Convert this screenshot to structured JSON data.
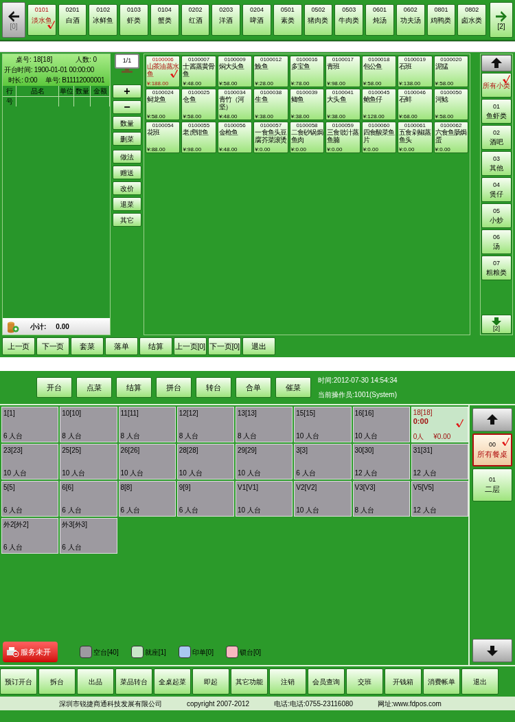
{
  "order_screen": {
    "category_bar": {
      "prev_page": "[0]",
      "next_page": "[2]",
      "categories": [
        {
          "code": "0101",
          "name": "淡水鱼",
          "selected": true
        },
        {
          "code": "0201",
          "name": "白酒",
          "selected": false
        },
        {
          "code": "0102",
          "name": "冰鲜鱼",
          "selected": false
        },
        {
          "code": "0103",
          "name": "虾类",
          "selected": false
        },
        {
          "code": "0104",
          "name": "蟹类",
          "selected": false
        },
        {
          "code": "0202",
          "name": "红酒",
          "selected": false
        },
        {
          "code": "0203",
          "name": "洋酒",
          "selected": false
        },
        {
          "code": "0204",
          "name": "啤酒",
          "selected": false
        },
        {
          "code": "0501",
          "name": "素类",
          "selected": false
        },
        {
          "code": "0502",
          "name": "猪肉类",
          "selected": false
        },
        {
          "code": "0503",
          "name": "牛肉类",
          "selected": false
        },
        {
          "code": "0601",
          "name": "炖汤",
          "selected": false
        },
        {
          "code": "0602",
          "name": "功夫汤",
          "selected": false
        },
        {
          "code": "0801",
          "name": "鸡鸭类",
          "selected": false
        },
        {
          "code": "0802",
          "name": "卤水类",
          "selected": false
        }
      ]
    },
    "order_info": {
      "table_no": "桌号: 18[18]",
      "guests": "人数: 0",
      "open_time": "开台时间: 1900-01-01 00:00:00",
      "duration": "时长: 0:00",
      "bill_no": "单号: B11112000001"
    },
    "order_table": {
      "columns": [
        "行号",
        "品名",
        "单位",
        "数量",
        "金额"
      ],
      "subtotal_label": "小计:",
      "subtotal": "0.00"
    },
    "page_indicator": "1/1",
    "edit_buttons": [
      "+",
      "−",
      "数量",
      "删菜",
      "做法",
      "赠送",
      "改价",
      "退菜",
      "其它"
    ],
    "dishes": [
      {
        "code": "0100006",
        "name": "山茶油蒸水鱼",
        "price": "¥:188.00",
        "selected": true
      },
      {
        "code": "0100007",
        "name": "士酱蒸黄骨鱼",
        "price": "¥:48.00",
        "selected": false
      },
      {
        "code": "0100009",
        "name": "焖大头鱼",
        "price": "¥:58.00",
        "selected": false
      },
      {
        "code": "0100012",
        "name": "鮸鱼",
        "price": "¥:28.00",
        "selected": false
      },
      {
        "code": "0100016",
        "name": "多宝鱼",
        "price": "¥:78.00",
        "selected": false
      },
      {
        "code": "0100017",
        "name": "青班",
        "price": "¥:98.00",
        "selected": false
      },
      {
        "code": "0100018",
        "name": "包公鱼",
        "price": "¥:58.00",
        "selected": false
      },
      {
        "code": "0100019",
        "name": "石班",
        "price": "¥:138.00",
        "selected": false
      },
      {
        "code": "0100020",
        "name": "泥猛",
        "price": "¥:58.00",
        "selected": false
      },
      {
        "code": "0100024",
        "name": "鲟龙鱼",
        "price": "¥:58.00",
        "selected": false
      },
      {
        "code": "0100025",
        "name": "仓鱼",
        "price": "¥:58.00",
        "selected": false
      },
      {
        "code": "0100034",
        "name": "青竹（河坚）",
        "price": "¥:48.00",
        "selected": false
      },
      {
        "code": "0100038",
        "name": "生鱼",
        "price": "¥:38.00",
        "selected": false
      },
      {
        "code": "0100039",
        "name": "鲫鱼",
        "price": "¥:38.00",
        "selected": false
      },
      {
        "code": "0100041",
        "name": "大头鱼",
        "price": "¥:38.00",
        "selected": false
      },
      {
        "code": "0100045",
        "name": "鲍鱼仔",
        "price": "¥:128.00",
        "selected": false
      },
      {
        "code": "0100046",
        "name": "石蚌",
        "price": "¥:68.00",
        "selected": false
      },
      {
        "code": "0100050",
        "name": "河鲶",
        "price": "¥:58.00",
        "selected": false
      },
      {
        "code": "0100054",
        "name": "花班",
        "price": "¥:88.00",
        "selected": false
      },
      {
        "code": "0100055",
        "name": "老虎钳鱼",
        "price": "¥:98.00",
        "selected": false
      },
      {
        "code": "0100056",
        "name": "金枪鱼",
        "price": "¥:48.00",
        "selected": false
      },
      {
        "code": "0100057",
        "name": "一食鱼头豆腐芥菜滚烫",
        "price": "¥:0.00",
        "selected": false
      },
      {
        "code": "0100058",
        "name": "二食砂锅焗鱼肉",
        "price": "¥:0.00",
        "selected": false
      },
      {
        "code": "0100059",
        "name": "三食豉汁蒸鱼腩",
        "price": "¥:0.00",
        "selected": false
      },
      {
        "code": "0100060",
        "name": "四食酸菜鱼片",
        "price": "¥:0.00",
        "selected": false
      },
      {
        "code": "0100061",
        "name": "五食剁椒蒸鱼头",
        "price": "¥:0.00",
        "selected": false
      },
      {
        "code": "0100062",
        "name": "六食鱼肠焗蛋",
        "price": "¥:0.00",
        "selected": false
      }
    ],
    "subcategories": {
      "next_page": "[2]",
      "items": [
        {
          "name": "所有小类",
          "selected": true
        },
        {
          "code": "01",
          "name": "鱼虾类",
          "selected": false
        },
        {
          "code": "02",
          "name": "酒吧",
          "selected": false
        },
        {
          "code": "03",
          "name": "其他",
          "selected": false
        },
        {
          "code": "04",
          "name": "煲仔",
          "selected": false
        },
        {
          "code": "05",
          "name": "小炒",
          "selected": false
        },
        {
          "code": "06",
          "name": "汤",
          "selected": false
        },
        {
          "code": "07",
          "name": "粗粮类",
          "selected": false
        }
      ]
    },
    "bottom_buttons": [
      "上一页",
      "下一页",
      "套菜",
      "落单",
      "结算",
      "上一页[0]",
      "下一页[0]",
      "退出"
    ]
  },
  "table_screen": {
    "actions": [
      "开台",
      "点菜",
      "结算",
      "拼台",
      "转台",
      "合单",
      "催菜"
    ],
    "time": "时间:2012-07-30 14:54:34",
    "operator": "当前操作员:1001(System)",
    "tables": [
      {
        "name": "1[1]",
        "capacity": "6 人台",
        "kind": "empty",
        "selected": false
      },
      {
        "name": "10[10]",
        "capacity": "8 人台",
        "kind": "empty",
        "selected": false
      },
      {
        "name": "11[11]",
        "capacity": "8 人台",
        "kind": "empty",
        "selected": false
      },
      {
        "name": "12[12]",
        "capacity": "8 人台",
        "kind": "empty",
        "selected": false
      },
      {
        "name": "13[13]",
        "capacity": "8 人台",
        "kind": "empty",
        "selected": false
      },
      {
        "name": "15[15]",
        "capacity": "10 人台",
        "kind": "empty",
        "selected": false
      },
      {
        "name": "16[16]",
        "capacity": "10 人台",
        "kind": "empty",
        "selected": false
      },
      {
        "name": "18[18]",
        "kind": "seated",
        "time": "0:00",
        "people": "0人",
        "amount": "¥0.00",
        "selected": true
      },
      {
        "name": "23[23]",
        "capacity": "10 人台",
        "kind": "empty",
        "selected": false
      },
      {
        "name": "25[25]",
        "capacity": "10 人台",
        "kind": "empty",
        "selected": false
      },
      {
        "name": "26[26]",
        "capacity": "10 人台",
        "kind": "empty",
        "selected": false
      },
      {
        "name": "28[28]",
        "capacity": "10 人台",
        "kind": "empty",
        "selected": false
      },
      {
        "name": "29[29]",
        "capacity": "10 人台",
        "kind": "empty",
        "selected": false
      },
      {
        "name": "3[3]",
        "capacity": "6 人台",
        "kind": "empty",
        "selected": false
      },
      {
        "name": "30[30]",
        "capacity": "12 人台",
        "kind": "empty",
        "selected": false
      },
      {
        "name": "31[31]",
        "capacity": "12 人台",
        "kind": "empty",
        "selected": false
      },
      {
        "name": "5[5]",
        "capacity": "6 人台",
        "kind": "empty",
        "selected": false
      },
      {
        "name": "6[6]",
        "capacity": "6 人台",
        "kind": "empty",
        "selected": false
      },
      {
        "name": "8[8]",
        "capacity": "6 人台",
        "kind": "empty",
        "selected": false
      },
      {
        "name": "9[9]",
        "capacity": "6 人台",
        "kind": "empty",
        "selected": false
      },
      {
        "name": "V1[V1]",
        "capacity": "10 人台",
        "kind": "empty",
        "selected": false
      },
      {
        "name": "V2[V2]",
        "capacity": "10 人台",
        "kind": "empty",
        "selected": false
      },
      {
        "name": "V3[V3]",
        "capacity": "8 人台",
        "kind": "empty",
        "selected": false
      },
      {
        "name": "V5[V5]",
        "capacity": "12 人台",
        "kind": "empty",
        "selected": false
      },
      {
        "name": "外2[外2]",
        "capacity": "6 人台",
        "kind": "empty",
        "selected": false
      },
      {
        "name": "外3[外3]",
        "capacity": "6 人台",
        "kind": "empty",
        "selected": false
      }
    ],
    "areas": [
      {
        "code": "00",
        "name": "所有餐桌",
        "selected": true
      },
      {
        "code": "01",
        "name": "二层",
        "selected": false
      }
    ],
    "service_button": "服务未开",
    "legend": [
      {
        "label": "空台[40]",
        "color": "#9d9aa0"
      },
      {
        "label": "就座[1]",
        "color": "#c8e6c8"
      },
      {
        "label": "印单[0]",
        "color": "#a8c8f0"
      },
      {
        "label": "锁台[0]",
        "color": "#f8b8c0"
      }
    ],
    "function_buttons": [
      "预订开台",
      "拆台",
      "出品",
      "菜品转台",
      "全桌起菜",
      "即起",
      "其它功能",
      "注销",
      "会员查询",
      "交班",
      "开钱箱",
      "消费帐单",
      "退出"
    ],
    "footer": {
      "company": "深圳市锐捷商通科技发展有限公司",
      "copyright": "copyright 2007-2012",
      "phone": "电话:电话:0755-23116080",
      "website": "网址:www.fdpos.com"
    }
  }
}
